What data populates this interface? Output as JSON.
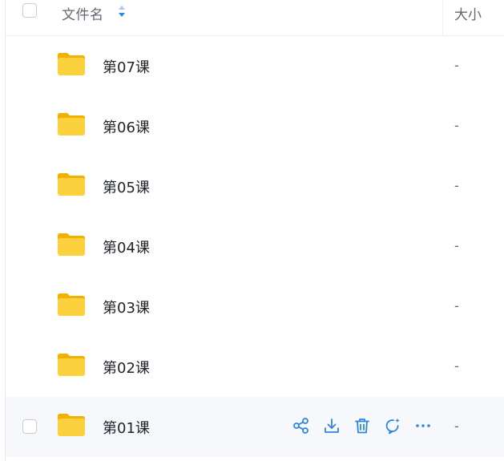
{
  "header": {
    "name_label": "文件名",
    "size_label": "大小"
  },
  "colors": {
    "accent": "#2e86de",
    "folder_yellow": "#f8c92c",
    "hover_bg": "#f6f8fb"
  },
  "rows": [
    {
      "name": "第07课",
      "size": "-"
    },
    {
      "name": "第06课",
      "size": "-"
    },
    {
      "name": "第05课",
      "size": "-"
    },
    {
      "name": "第04课",
      "size": "-"
    },
    {
      "name": "第03课",
      "size": "-"
    },
    {
      "name": "第02课",
      "size": "-"
    },
    {
      "name": "第01课",
      "size": "-"
    }
  ],
  "hover_actions": [
    "share-icon",
    "download-icon",
    "delete-icon",
    "ai-chat-icon",
    "more-icon"
  ]
}
